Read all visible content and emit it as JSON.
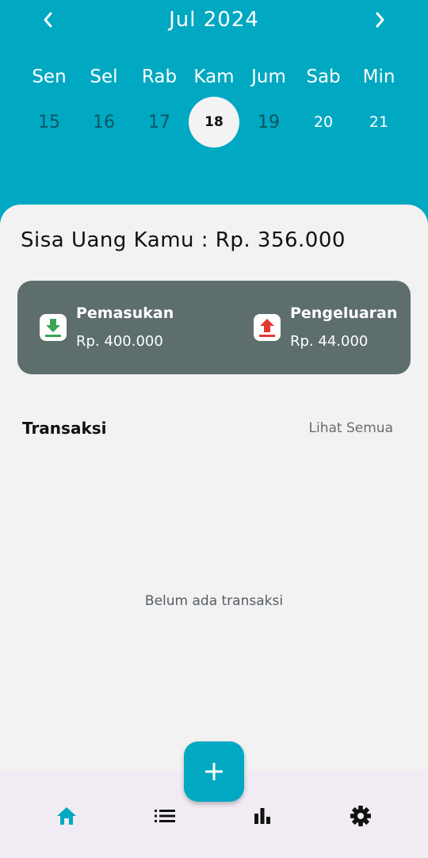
{
  "calendar": {
    "month_label": "Jul 2024",
    "weekdays": [
      "Sen",
      "Sel",
      "Rab",
      "Kam",
      "Jum",
      "Sab",
      "Min"
    ],
    "dates": [
      "15",
      "16",
      "17",
      "18",
      "19",
      "20",
      "21"
    ],
    "selected_date": "18"
  },
  "balance": {
    "text": "Sisa Uang Kamu : Rp. 356.000"
  },
  "summary": {
    "income_label": "Pemasukan",
    "income_value": "Rp. 400.000",
    "expense_label": "Pengeluaran",
    "expense_value": "Rp. 44.000"
  },
  "transactions": {
    "title": "Transaksi",
    "see_all": "Lihat Semua",
    "empty_text": "Belum ada transaksi"
  },
  "icons": {
    "prev": "chevron-left-icon",
    "next": "chevron-right-icon",
    "income": "download-icon",
    "expense": "upload-icon",
    "add": "plus-icon",
    "nav": [
      "home-icon",
      "list-icon",
      "bar-chart-icon",
      "gear-icon"
    ]
  },
  "colors": {
    "primary": "#00a8c2",
    "summary_bg": "#5d6e6d",
    "income": "#3aa655",
    "expense": "#e53935",
    "nav_active": "#00a8c2"
  }
}
